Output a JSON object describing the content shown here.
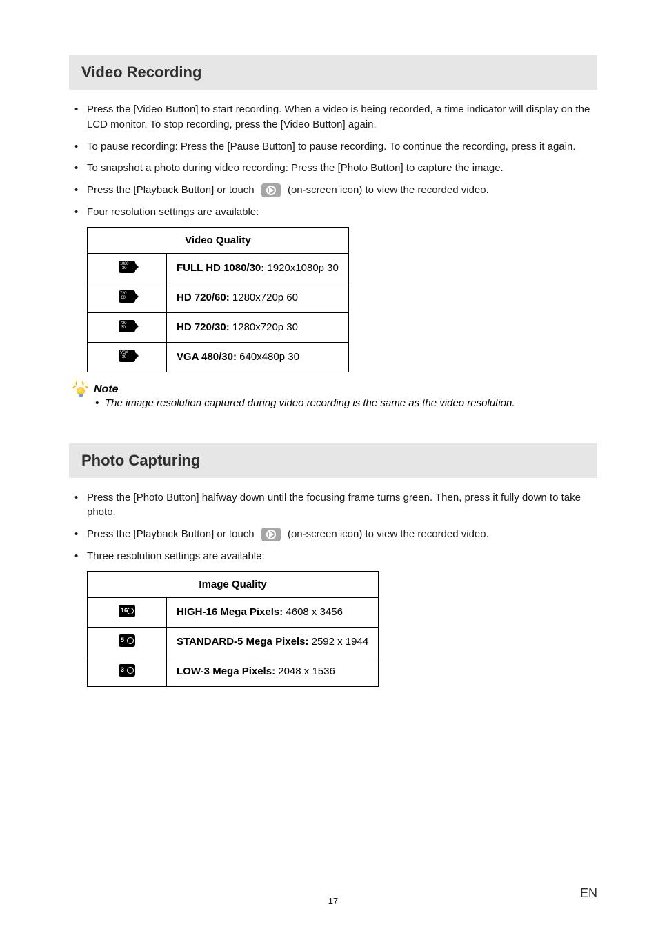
{
  "section1": {
    "title": "Video Recording",
    "bullets": [
      "Press the [Video Button] to start recording. When a video is being recorded, a time indicator will display on the LCD monitor. To stop recording, press the [Video Button] again.",
      "To pause recording: Press the [Pause Button] to pause recording. To continue the recording, press it again.",
      "To snapshot a photo during video recording: Press the [Photo Button] to capture the image."
    ],
    "playback_prefix": "Press the [Playback Button] or touch ",
    "playback_suffix": " (on-screen icon) to view the recorded video.",
    "bullet_last": "Four resolution settings are available:",
    "table_header": "Video Quality",
    "rows": [
      {
        "label_bold": "FULL HD 1080/30:",
        "label_rest": " 1920x1080p 30"
      },
      {
        "label_bold": "HD 720/60:",
        "label_rest": " 1280x720p 60"
      },
      {
        "label_bold": "HD 720/30:",
        "label_rest": " 1280x720p 30"
      },
      {
        "label_bold": "VGA 480/30:",
        "label_rest": " 640x480p 30"
      }
    ]
  },
  "note": {
    "title": "Note",
    "text": "The image resolution captured during video recording is the same as the video resolution."
  },
  "section2": {
    "title": "Photo Capturing",
    "bullet1": "Press the [Photo Button] halfway down until the focusing frame turns green. Then, press it fully down to take photo.",
    "playback_prefix": "Press the [Playback Button] or touch ",
    "playback_suffix": " (on-screen icon) to view the recorded video.",
    "bullet_last": "Three resolution settings are available:",
    "table_header": "Image Quality",
    "rows": [
      {
        "num": "16",
        "label_bold": "HIGH-16 Mega Pixels:",
        "label_rest": " 4608 x 3456"
      },
      {
        "num": "5",
        "label_bold": "STANDARD-5 Mega Pixels:",
        "label_rest": " 2592 x 1944"
      },
      {
        "num": "3",
        "label_bold": "LOW-3 Mega Pixels:",
        "label_rest": " 2048 x 1536"
      }
    ]
  },
  "footer": {
    "page": "17",
    "lang": "EN"
  }
}
